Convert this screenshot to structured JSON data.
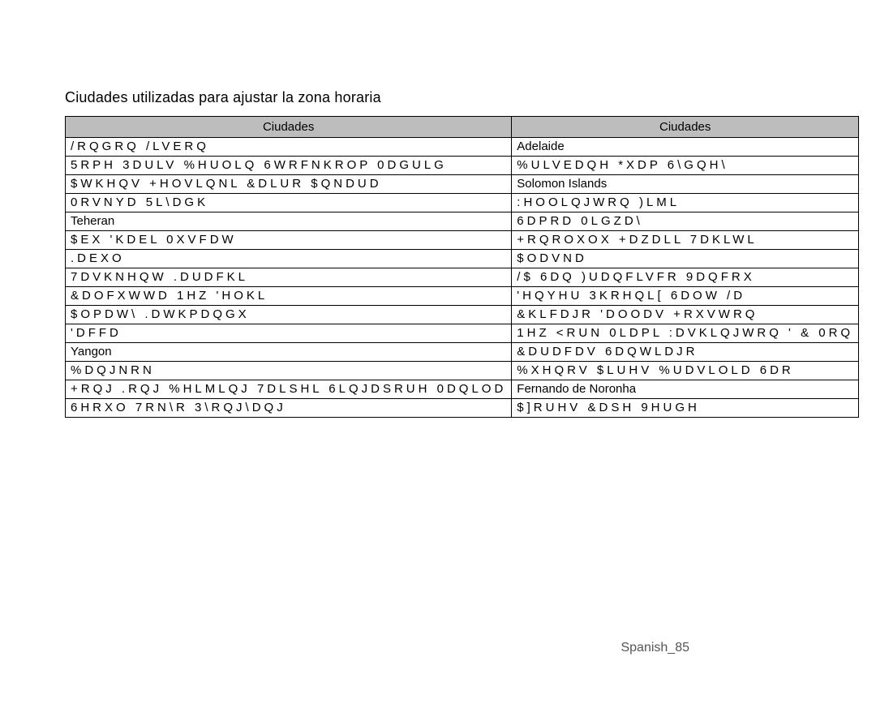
{
  "title": "Ciudades utilizadas para ajustar la zona horaria",
  "header": {
    "col1": "Ciudades",
    "col2": "Ciudades"
  },
  "rows": [
    {
      "l": "/RQGRQ /LVERQ",
      "lCls": "spaced",
      "r": "Adelaide",
      "rCls": ""
    },
    {
      "l": "5RPH 3DULV %HUOLQ 6WRFNKROP 0DGULG",
      "lCls": "spaced",
      "r": "%ULVEDQH *XDP 6\\GQH\\",
      "rCls": "spaced"
    },
    {
      "l": "$WKHQV +HOVLQNL &DLUR $QNDUD",
      "lCls": "spaced",
      "r": "Solomon Islands",
      "rCls": ""
    },
    {
      "l": "0RVNYD 5L\\DGK",
      "lCls": "spaced",
      "r": ":HOOLQJWRQ )LML",
      "rCls": "spaced"
    },
    {
      "l": "Teheran",
      "lCls": "",
      "r": "6DPRD 0LGZD\\",
      "rCls": "spaced"
    },
    {
      "l": "$EX 'KDEL 0XVFDW",
      "lCls": "spaced-mixed",
      "r": "+RQROXOX +DZDLL 7DKLWL",
      "rCls": "spaced"
    },
    {
      "l": ".DEXO",
      "lCls": "spaced",
      "r": "$ODVND",
      "rCls": "spaced"
    },
    {
      "l": "7DVKNHQW .DUDFKL",
      "lCls": "spaced",
      "r": "/$ 6DQ )UDQFLVFR 9DQFRX",
      "rCls": "spaced"
    },
    {
      "l": "&DOFXWWD 1HZ 'HOKL",
      "lCls": "spaced-mixed",
      "r": "'HQYHU 3KRHQL[ 6DOW /D",
      "rCls": "spaced-mixed"
    },
    {
      "l": "$OPDW\\ .DWKPDQGX",
      "lCls": "spaced",
      "r": "&KLFDJR 'DOODV +RXVWRQ",
      "rCls": "spaced-mixed"
    },
    {
      "l": "'DFFD",
      "lCls": "spaced-mixed",
      "r": "1HZ <RUN 0LDPL :DVKLQJWRQ ' & 0RQ",
      "rCls": "spaced-mixed"
    },
    {
      "l": "Yangon",
      "lCls": "",
      "r": "&DUDFDV 6DQWLDJR",
      "rCls": "spaced"
    },
    {
      "l": "%DQJNRN",
      "lCls": "spaced",
      "r": "%XHQRV $LUHV %UDVLOLD 6DR",
      "rCls": "spaced"
    },
    {
      "l": "+RQJ .RQJ %HLMLQJ 7DLSHL 6LQJDSRUH 0DQLOD",
      "lCls": "spaced-mixed",
      "r": "Fernando de Noronha",
      "rCls": ""
    },
    {
      "l": "6HRXO 7RN\\R 3\\RQJ\\DQJ",
      "lCls": "spaced",
      "r": "$]RUHV &DSH 9HUGH",
      "rCls": "spaced"
    }
  ],
  "footer": "Spanish_85"
}
